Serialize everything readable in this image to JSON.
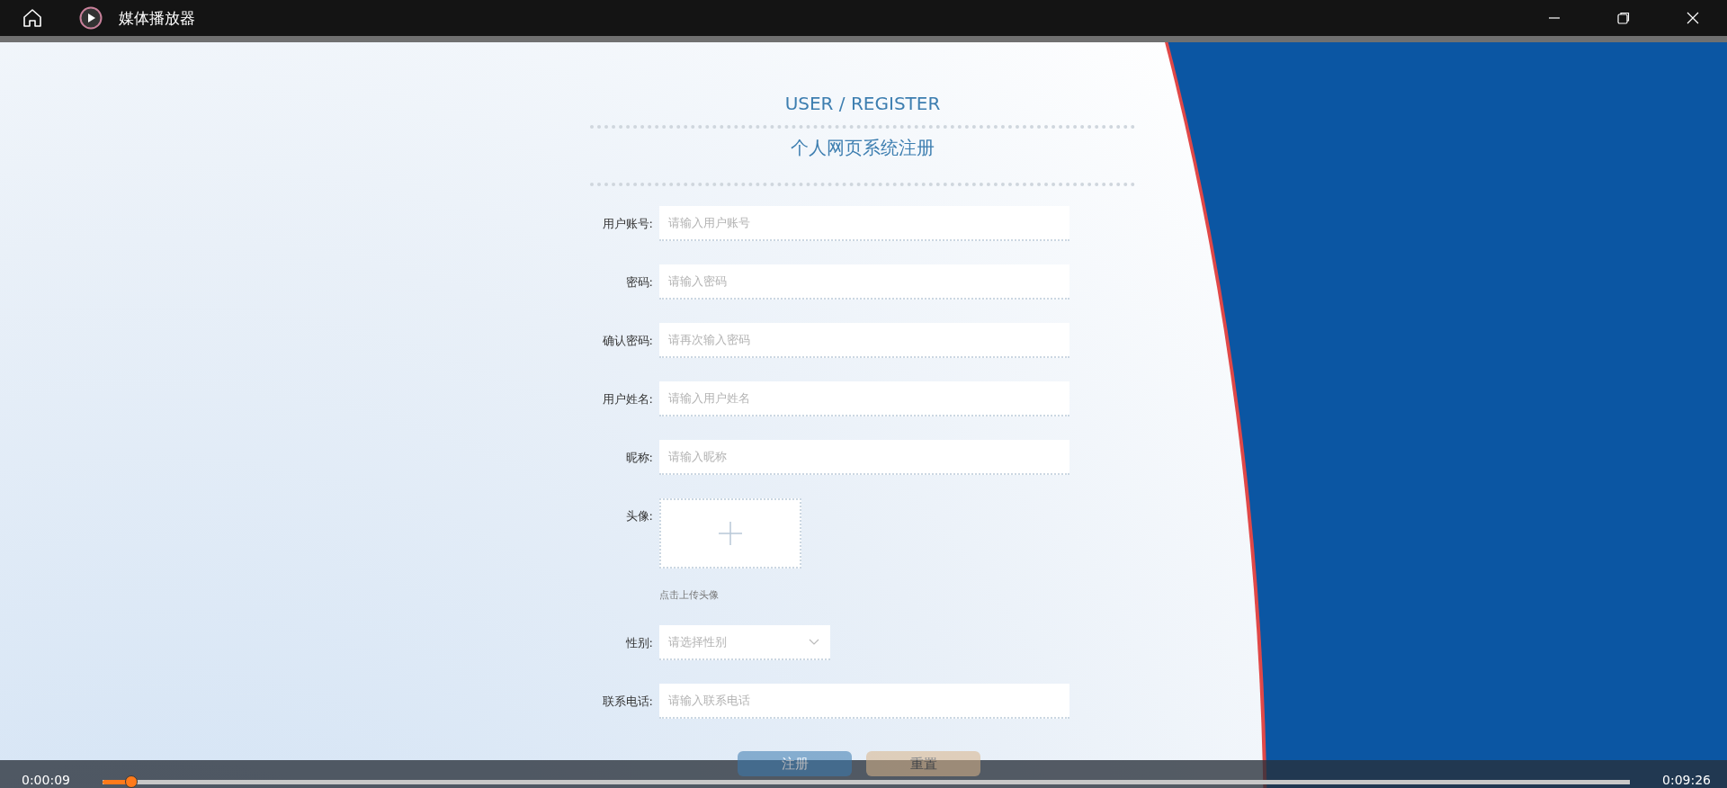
{
  "window": {
    "title": "媒体播放器"
  },
  "form": {
    "heading": "USER / REGISTER",
    "title": "个人网页系统注册",
    "fields": [
      {
        "kind": "text",
        "label": "用户账号:",
        "placeholder": "请输入用户账号"
      },
      {
        "kind": "text",
        "label": "密码:",
        "placeholder": "请输入密码"
      },
      {
        "kind": "text",
        "label": "确认密码:",
        "placeholder": "请再次输入密码"
      },
      {
        "kind": "text",
        "label": "用户姓名:",
        "placeholder": "请输入用户姓名"
      },
      {
        "kind": "text",
        "label": "昵称:",
        "placeholder": "请输入昵称"
      },
      {
        "kind": "upload",
        "label": "头像:",
        "hint": "点击上传头像"
      },
      {
        "kind": "select",
        "label": "性别:",
        "placeholder": "请选择性别"
      },
      {
        "kind": "text",
        "label": "联系电话:",
        "placeholder": "请输入联系电话"
      }
    ],
    "buttons": [
      {
        "label": "注册",
        "kind": "primary"
      },
      {
        "label": "重置",
        "kind": "secondary"
      }
    ]
  },
  "player": {
    "elapsed": "0:00:09",
    "duration": "0:09:26",
    "level": 0.02
  }
}
